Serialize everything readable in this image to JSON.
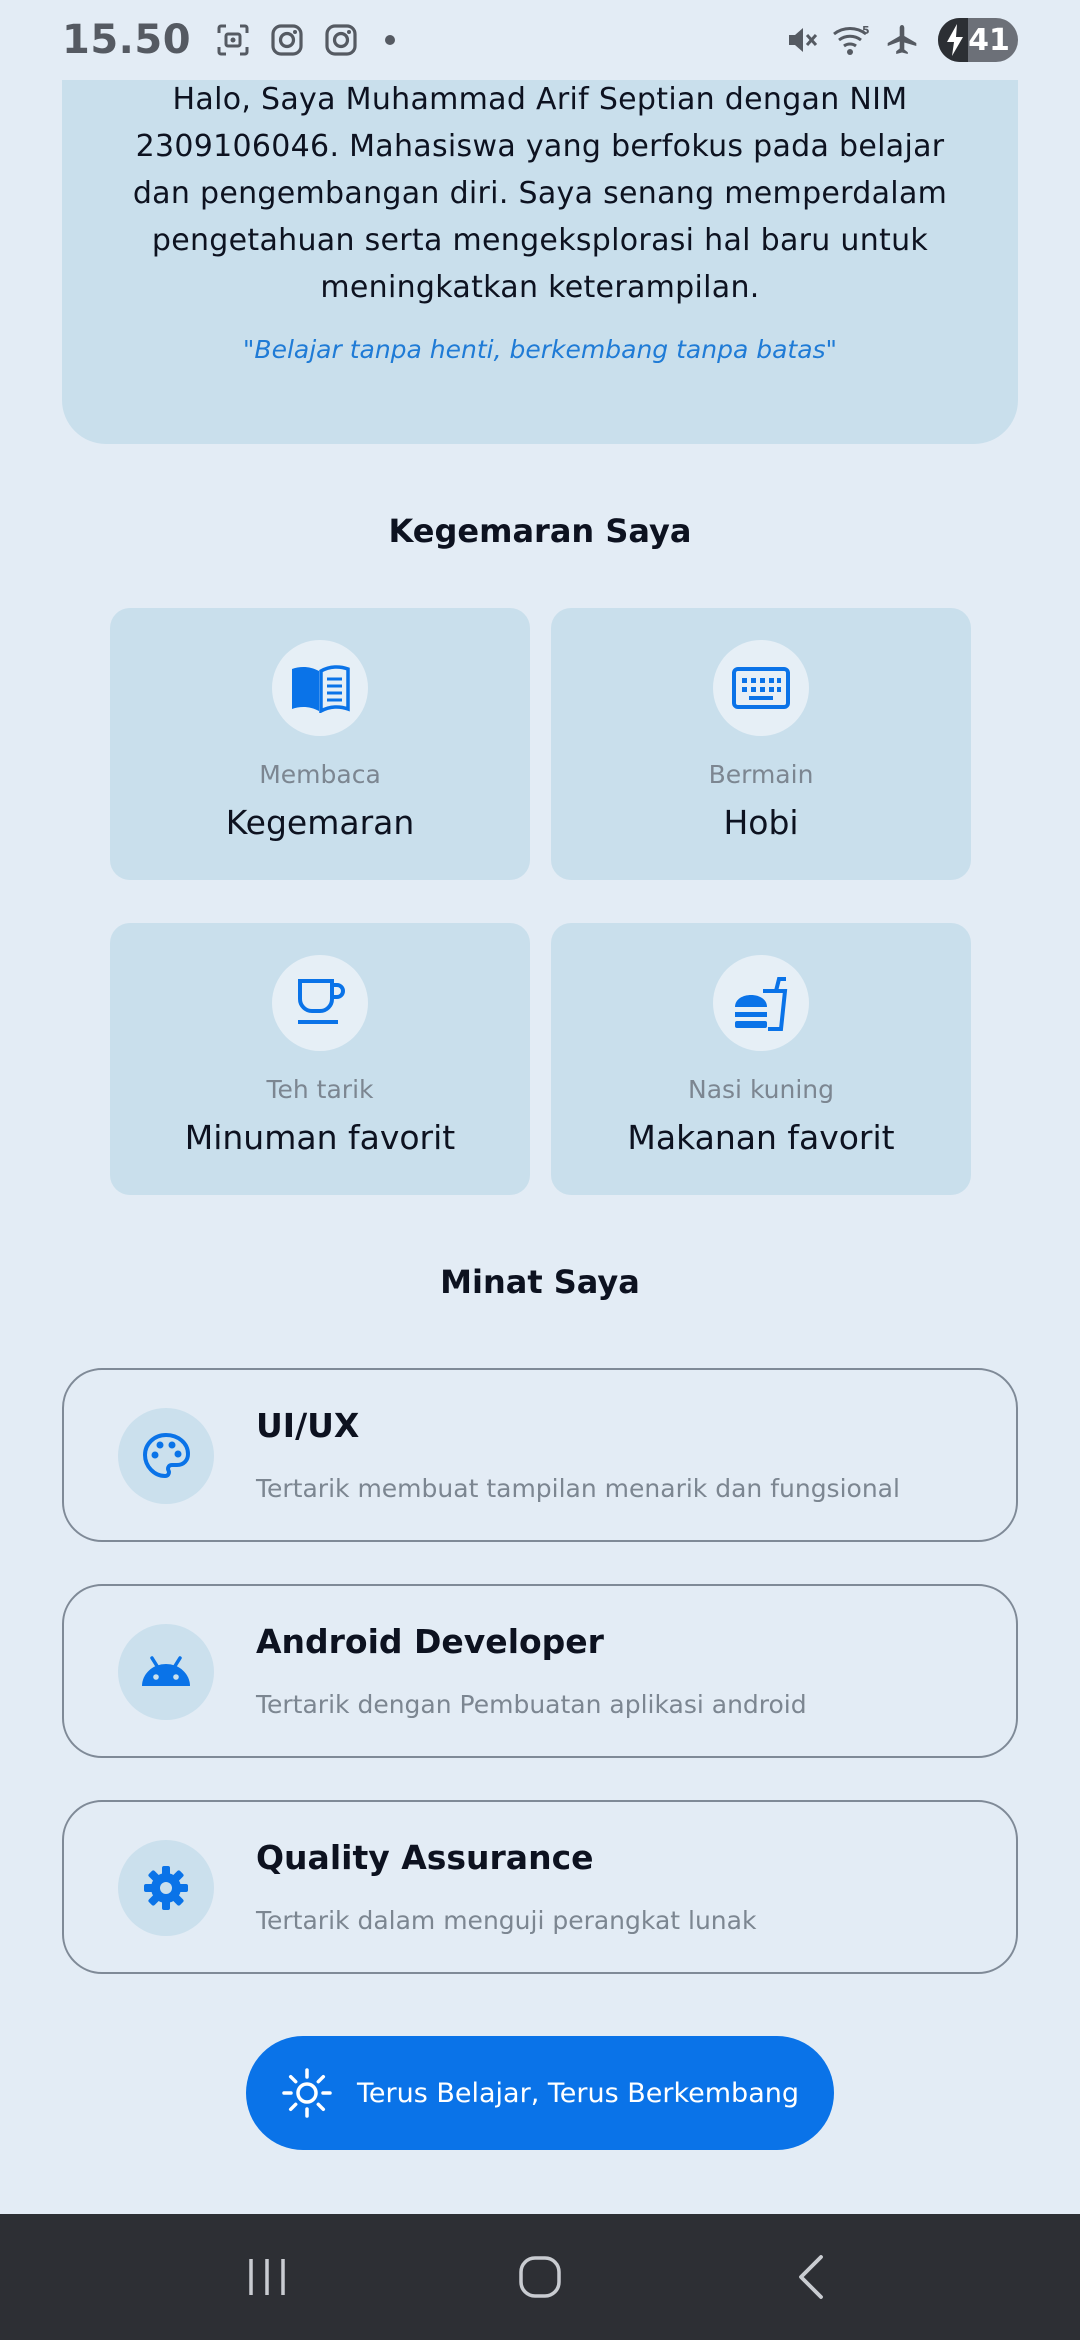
{
  "status_bar": {
    "time": "15.50",
    "battery": "41",
    "icons": [
      "screenshot-icon",
      "instagram-icon",
      "instagram-icon",
      "notification-dot",
      "mute-icon",
      "wifi-icon",
      "airplane-icon",
      "battery-icon"
    ]
  },
  "intro": {
    "text": "Halo, Saya Muhammad Arif Septian dengan NIM 2309106046. Mahasiswa yang berfokus pada belajar dan pengembangan diri. Saya senang memperdalam pengetahuan serta mengeksplorasi hal baru untuk meningkatkan keterampilan.",
    "quote": "\"Belajar tanpa henti, berkembang tanpa batas\""
  },
  "hobbies": {
    "title": "Kegemaran Saya",
    "items": [
      {
        "icon": "book-icon",
        "sub": "Membaca",
        "main": "Kegemaran"
      },
      {
        "icon": "keyboard-icon",
        "sub": "Bermain",
        "main": "Hobi"
      },
      {
        "icon": "cup-icon",
        "sub": "Teh tarik",
        "main": "Minuman favorit"
      },
      {
        "icon": "fastfood-icon",
        "sub": "Nasi kuning",
        "main": "Makanan favorit"
      }
    ]
  },
  "interests": {
    "title": "Minat Saya",
    "items": [
      {
        "icon": "palette-icon",
        "title": "UI/UX",
        "desc": "Tertarik membuat tampilan menarik dan fungsional"
      },
      {
        "icon": "android-icon",
        "title": "Android Developer",
        "desc": "Tertarik dengan Pembuatan aplikasi android"
      },
      {
        "icon": "gear-icon",
        "title": "Quality Assurance",
        "desc": "Tertarik dalam menguji perangkat lunak"
      }
    ]
  },
  "cta": {
    "label": "Terus Belajar, Terus Berkembang",
    "icon": "sun-icon"
  },
  "nav": {
    "buttons": [
      "recent-apps-icon",
      "home-icon",
      "back-icon"
    ]
  },
  "colors": {
    "background": "#e3ecf5",
    "card": "#c9dfec",
    "accent": "#0a73e8",
    "quote": "#1f7bd6",
    "muted_text": "#7c8691",
    "nav_bar": "#2d2f34"
  }
}
